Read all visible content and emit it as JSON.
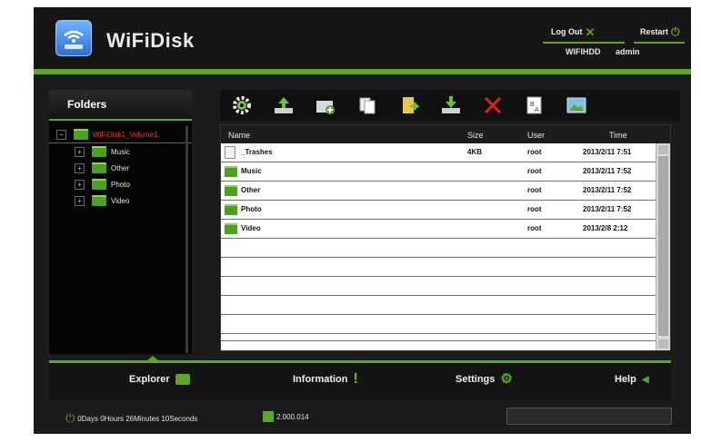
{
  "header": {
    "brand": "WiFiDisk",
    "logout_label": "Log Out",
    "restart_label": "Restart",
    "device_name": "WIFIHDD",
    "user": "admin"
  },
  "folders": {
    "title": "Folders",
    "root": "WiFiDisk1_Volume1",
    "items": [
      {
        "label": "Music"
      },
      {
        "label": "Other"
      },
      {
        "label": "Photo"
      },
      {
        "label": "Video"
      }
    ]
  },
  "toolbar": {
    "icons": [
      "settings-gear-icon",
      "upload-icon",
      "add-folder-icon",
      "copy-icon",
      "move-icon",
      "download-icon",
      "delete-icon",
      "rename-icon",
      "preview-icon"
    ]
  },
  "file_list": {
    "columns": {
      "name": "Name",
      "size": "Size",
      "user": "User",
      "time": "Time"
    },
    "rows": [
      {
        "name": "_Trashes",
        "size": "4KB",
        "user": "root",
        "time": "2013/2/11 7:51",
        "icon": "document-icon"
      },
      {
        "name": "Music",
        "size": "",
        "user": "root",
        "time": "2013/2/11 7:52",
        "icon": "folder-icon"
      },
      {
        "name": "Other",
        "size": "",
        "user": "root",
        "time": "2013/2/11 7:52",
        "icon": "folder-icon"
      },
      {
        "name": "Photo",
        "size": "",
        "user": "root",
        "time": "2013/2/11 7:52",
        "icon": "folder-icon"
      },
      {
        "name": "Video",
        "size": "",
        "user": "root",
        "time": "2013/2/8 2:12",
        "icon": "folder-icon"
      }
    ],
    "empty_rows": 6
  },
  "nav": {
    "explorer": "Explorer",
    "information": "Information",
    "settings": "Settings",
    "help": "Help"
  },
  "status": {
    "uptime": "0Days 0Hours 26Minutes 10Seconds",
    "version": "2.000.014"
  },
  "colors": {
    "accent": "#5da62b",
    "background": "#1b1b1b",
    "tree_root": "#e43b2b"
  }
}
